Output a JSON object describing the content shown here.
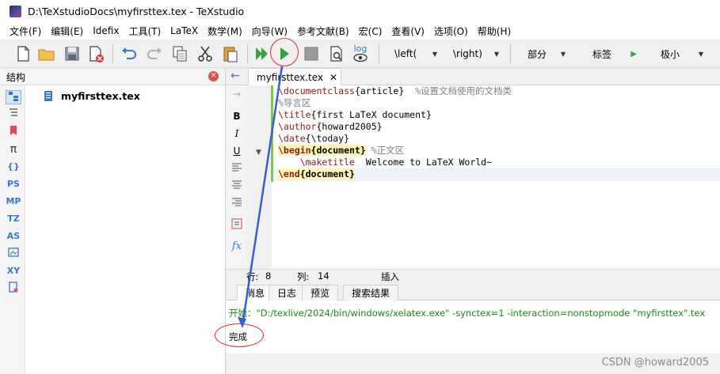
{
  "window": {
    "title": "D:\\TeXstudioDocs\\myfirsttex.tex - TeXstudio"
  },
  "menu": [
    "文件(F)",
    "编辑(E)",
    "Idefix",
    "工具(T)",
    "LaTeX",
    "数学(M)",
    "向导(W)",
    "参考文献(B)",
    "宏(C)",
    "查看(V)",
    "选项(O)",
    "帮助(H)"
  ],
  "toolbar": {
    "log_label": "log",
    "combo_left": "\\left(",
    "combo_right": "\\right)",
    "combo_part": "部分",
    "combo_label": "标签",
    "combo_size": "极小"
  },
  "structure": {
    "title": "结构",
    "file": "myfirsttex.tex",
    "side_icons": [
      "PS",
      "MP",
      "TZ",
      "AS",
      "XY"
    ]
  },
  "editor": {
    "tab": "myfirsttex.tex",
    "lines": {
      "l1_cmd": "\\documentclass",
      "l1_arg": "{article}",
      "l1_comment": "  %设置文档使用的文档类",
      "l2": "%导言区",
      "l3_cmd": "\\title",
      "l3_arg": "{first LaTeX document}",
      "l4_cmd": "\\author",
      "l4_arg": "{howard2005}",
      "l5_cmd": "\\date",
      "l5_arg": "{\\today}",
      "l6_cmd": "\\begin",
      "l6_env": "{document}",
      "l6_comment": " %正文区",
      "l7_cmd": "    \\maketitle",
      "l7_text": "  Welcome to LaTeX World~",
      "l8_cmd": "\\end",
      "l8_env": "{document}"
    }
  },
  "status": {
    "row_label": "行:",
    "row": "8",
    "col_label": "列:",
    "col": "14",
    "mode": "插入"
  },
  "bottom": {
    "tabs": [
      "消息",
      "日志",
      "预览",
      "搜索结果"
    ],
    "log_line": "开始：\"D:/texlive/2024/bin/windows/xelatex.exe\" -synctex=1 -interaction=nonstopmode \"myfirsttex\".tex",
    "done": "完成"
  },
  "watermark": "CSDN @howard2005",
  "colors": {
    "accent": "#3a78c8",
    "annotation": "#d03030",
    "run_green": "#3aa040"
  }
}
